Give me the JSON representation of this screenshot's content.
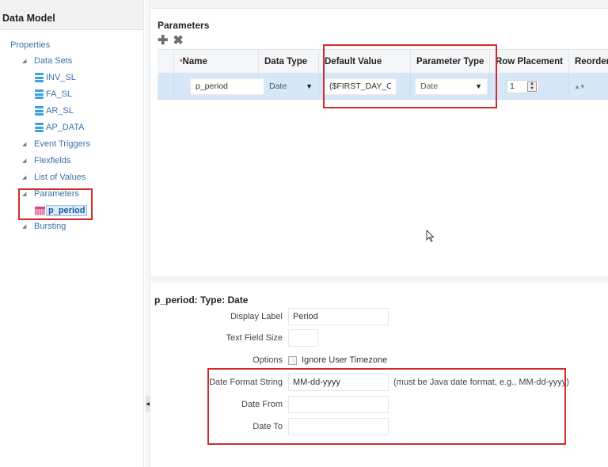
{
  "left_panel": {
    "title": "Data Model",
    "root": "Properties",
    "tree": [
      {
        "label": "Data Sets",
        "children": [
          "INV_SL",
          "FA_SL",
          "AR_SL",
          "AP_DATA"
        ]
      },
      {
        "label": "Event Triggers"
      },
      {
        "label": "Flexfields"
      },
      {
        "label": "List of Values"
      },
      {
        "label": "Parameters",
        "children": [
          "p_period"
        ]
      },
      {
        "label": "Bursting"
      }
    ]
  },
  "parameters": {
    "title": "Parameters",
    "add_icon": "plus-icon",
    "delete_icon": "x-icon",
    "columns": [
      "Name",
      "Data Type",
      "Default Value",
      "Parameter Type",
      "Row Placement",
      "Reorder"
    ],
    "required_marker": "*",
    "rows": [
      {
        "name": "p_period",
        "data_type": "Date",
        "default_value": "{$FIRST_DAY_OF_",
        "parameter_type": "Date",
        "row_placement": "1",
        "reorder_glyph": "▲▼"
      }
    ]
  },
  "details": {
    "title": "p_period: Type: Date",
    "fields": {
      "display_label": {
        "label": "Display Label",
        "value": "Period"
      },
      "text_field_size": {
        "label": "Text Field Size",
        "value": ""
      },
      "options": {
        "label": "Options",
        "checkbox_label": "Ignore User Timezone",
        "checked": false
      },
      "date_format": {
        "label": "Date Format String",
        "value": "MM-dd-yyyy",
        "hint": "(must be Java date format, e.g., MM-dd-yyyy)"
      },
      "date_from": {
        "label": "Date From",
        "value": ""
      },
      "date_to": {
        "label": "Date To",
        "value": ""
      }
    }
  },
  "colors": {
    "highlight_box": "#d02b2b",
    "link_blue": "#3b72a8",
    "selected_row": "#d6e8f8"
  }
}
